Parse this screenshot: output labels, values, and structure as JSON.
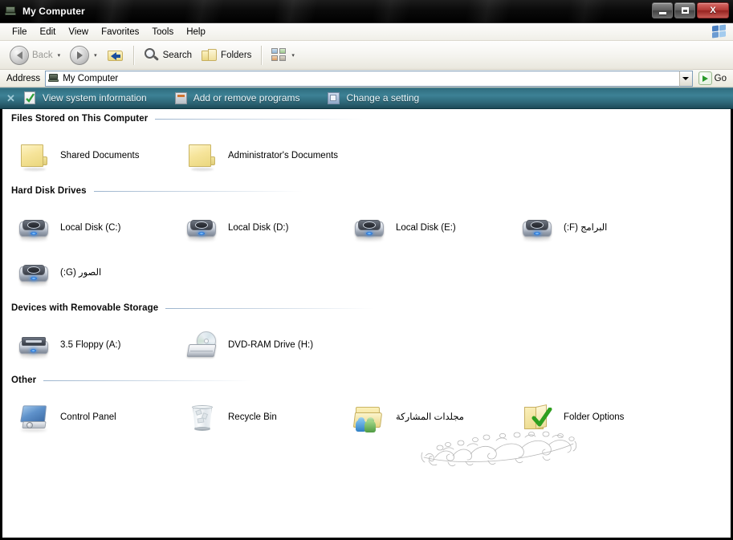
{
  "window": {
    "title": "My Computer",
    "title_icon": "my-computer-icon",
    "caption": {
      "minimize": "minimize",
      "maximize": "maximize",
      "close": "X"
    }
  },
  "menu": {
    "items": [
      "File",
      "Edit",
      "View",
      "Favorites",
      "Tools",
      "Help"
    ],
    "brand_icon": "windows-flag-icon"
  },
  "toolbar": {
    "back_label": "Back",
    "back_icon": "back-arrow-icon",
    "forward_icon": "forward-arrow-icon",
    "up_icon": "up-one-level-icon",
    "search_label": "Search",
    "search_icon": "search-magnifier-icon",
    "folders_label": "Folders",
    "folders_icon": "folders-icon",
    "views_icon": "views-thumbnails-icon",
    "dropdown_caret": "▾"
  },
  "address": {
    "label": "Address",
    "value": "My Computer",
    "icon": "my-computer-icon",
    "dropdown_icon": "chevron-down-icon",
    "go_label": "Go",
    "go_icon": "go-arrow-icon"
  },
  "taskband": {
    "close_glyph": "✕",
    "items": [
      {
        "label": "View system information",
        "icon": "system-info-icon"
      },
      {
        "label": "Add or remove programs",
        "icon": "add-remove-programs-icon"
      },
      {
        "label": "Change a setting",
        "icon": "change-setting-icon"
      }
    ]
  },
  "groups": [
    {
      "title": "Files Stored on This Computer",
      "items": [
        {
          "label": "Shared Documents",
          "icon": "folder-icon",
          "rtl": false
        },
        {
          "label": "Administrator's Documents",
          "icon": "folder-icon",
          "rtl": false
        }
      ]
    },
    {
      "title": "Hard Disk Drives",
      "items": [
        {
          "label": "Local Disk (C:)",
          "icon": "hard-disk-icon",
          "rtl": false
        },
        {
          "label": "Local Disk (D:)",
          "icon": "hard-disk-icon",
          "rtl": false
        },
        {
          "label": "Local Disk (E:)",
          "icon": "hard-disk-icon",
          "rtl": false
        },
        {
          "label": "البرامج (F:)",
          "icon": "hard-disk-icon",
          "rtl": true
        },
        {
          "label": "الصور (G:)",
          "icon": "hard-disk-icon",
          "rtl": true
        }
      ]
    },
    {
      "title": "Devices with Removable Storage",
      "items": [
        {
          "label": "3.5 Floppy (A:)",
          "icon": "floppy-drive-icon",
          "rtl": false
        },
        {
          "label": "DVD-RAM Drive (H:)",
          "icon": "dvd-ram-drive-icon",
          "rtl": false
        }
      ]
    },
    {
      "title": "Other",
      "items": [
        {
          "label": "Control Panel",
          "icon": "control-panel-icon",
          "rtl": false
        },
        {
          "label": "Recycle Bin",
          "icon": "recycle-bin-icon",
          "rtl": false
        },
        {
          "label": "مجلدات المشاركة",
          "icon": "shared-folders-icon",
          "rtl": true
        },
        {
          "label": "Folder Options",
          "icon": "folder-options-icon",
          "rtl": false
        }
      ]
    }
  ],
  "watermark": {
    "text": "منتديات شبكة كويتيات",
    "style": "arabic-calligraphy-outline"
  },
  "colors": {
    "titlebar": "#000000",
    "taskband": "#3c8195",
    "content_bg": "#ffffff",
    "close_button": "#b23a36",
    "group_rule": "#9cb4cd"
  }
}
